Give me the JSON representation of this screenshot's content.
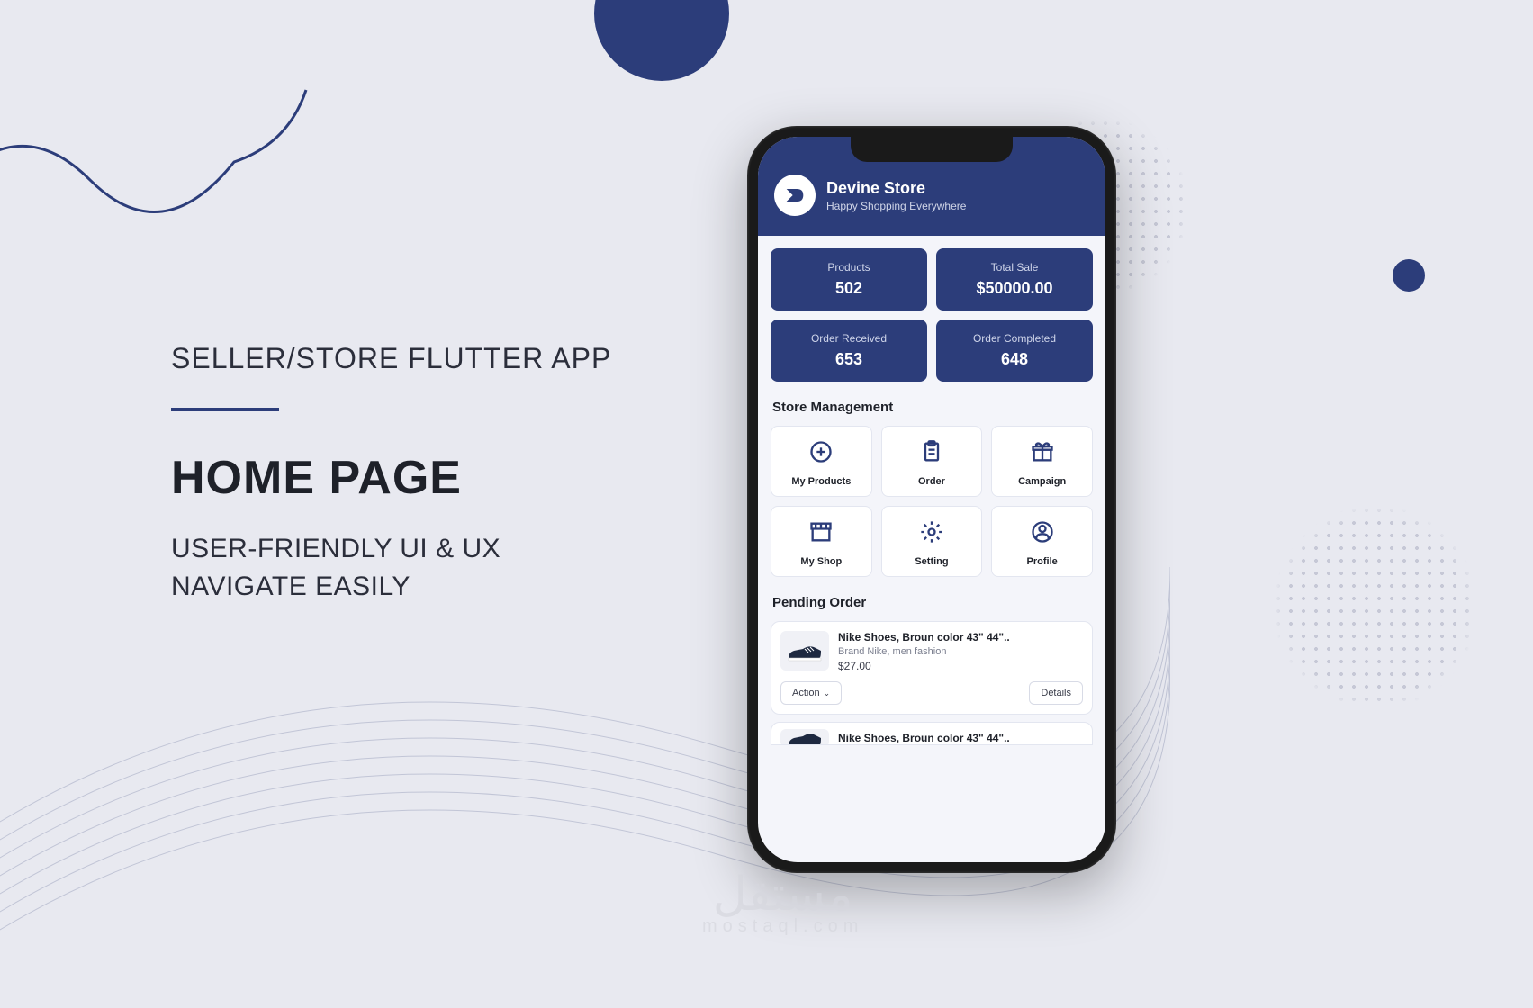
{
  "marketing": {
    "subtitle": "SELLER/STORE FLUTTER APP",
    "title": "HOME PAGE",
    "desc1": "USER-FRIENDLY UI & UX",
    "desc2": "NAVIGATE EASILY"
  },
  "app": {
    "store_name": "Devine Store",
    "store_tagline": "Happy Shopping Everywhere",
    "stats": [
      {
        "label": "Products",
        "value": "502"
      },
      {
        "label": "Total Sale",
        "value": "$50000.00"
      },
      {
        "label": "Order Received",
        "value": "653"
      },
      {
        "label": "Order Completed",
        "value": "648"
      }
    ],
    "store_management_title": "Store Management",
    "mgmt": [
      {
        "label": "My Products"
      },
      {
        "label": "Order"
      },
      {
        "label": "Campaign"
      },
      {
        "label": "My Shop"
      },
      {
        "label": "Setting"
      },
      {
        "label": "Profile"
      }
    ],
    "pending_order_title": "Pending Order",
    "orders": [
      {
        "title": "Nike Shoes, Broun color 43\" 44\"..",
        "subtitle": "Brand Nike, men fashion",
        "price": "$27.00",
        "action_label": "Action",
        "details_label": "Details"
      },
      {
        "title": "Nike Shoes, Broun color 43\" 44\".."
      }
    ]
  },
  "watermark": {
    "arabic": "مستقل",
    "latin": "mostaql.com"
  }
}
